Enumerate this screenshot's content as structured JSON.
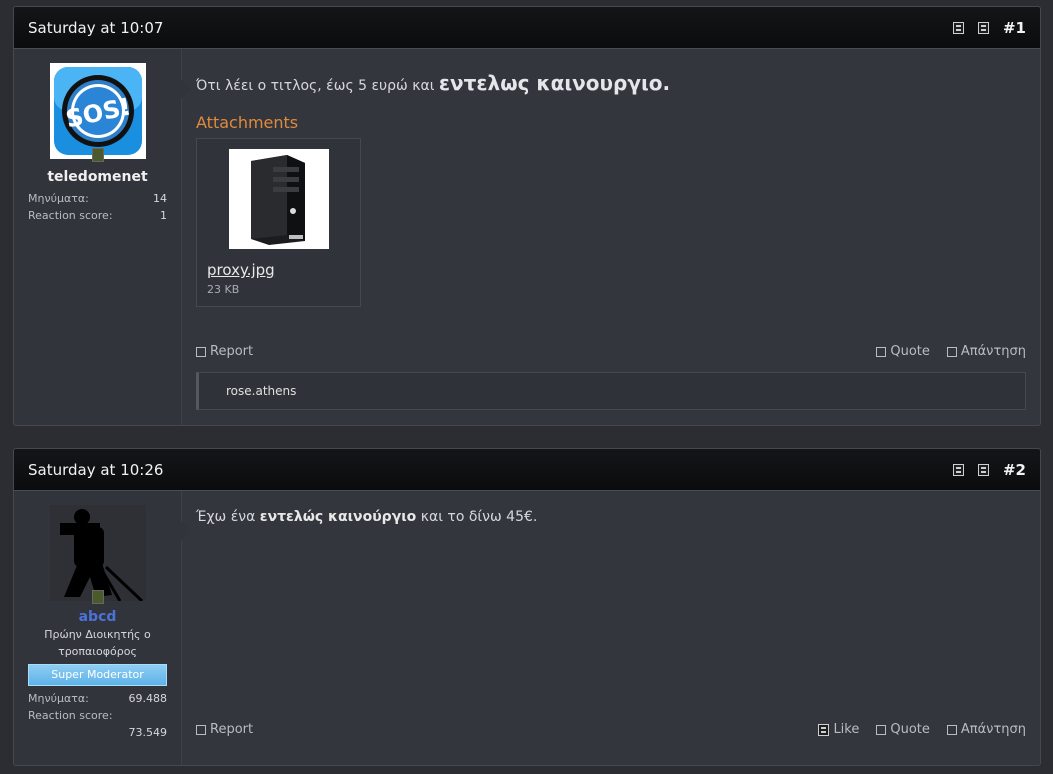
{
  "posts": [
    {
      "date": "Saturday at 10:07",
      "number": "#1",
      "user": {
        "name": "teledomenet",
        "stats": [
          {
            "label": "Μηνύματα:",
            "value": "14"
          },
          {
            "label": "Reaction score:",
            "value": "1"
          }
        ]
      },
      "message_plain": "Ότι λέει ο τιτλος, έως 5 ευρώ και ",
      "message_big": "εντελως καινουργιο.",
      "attachments_title": "Attachments",
      "attachment": {
        "name": "proxy.jpg",
        "size": "23 KB"
      },
      "actions": {
        "report": "Report",
        "quote": "Quote",
        "reply": "Απάντηση"
      },
      "signature": "rose.athens"
    },
    {
      "date": "Saturday at 10:26",
      "number": "#2",
      "user": {
        "name": "abcd",
        "title": "Πρώην Διοικητής ο τροπαιοφόρος",
        "banner": "Super Moderator",
        "stats": [
          {
            "label": "Μηνύματα:",
            "value": "69.488"
          },
          {
            "label": "Reaction score:",
            "value": "73.549"
          }
        ]
      },
      "message_a": "Έχω ένα ",
      "message_bold": "εντελώς καινούργιο",
      "message_b": " και το δίνω 45€.",
      "actions": {
        "report": "Report",
        "like": "Like",
        "quote": "Quote",
        "reply": "Απάντηση"
      }
    }
  ],
  "colors": {
    "accent_orange": "#e08a3c",
    "moderator_blue": "#4a73d9",
    "banner_blue": "#7cc2ee"
  }
}
